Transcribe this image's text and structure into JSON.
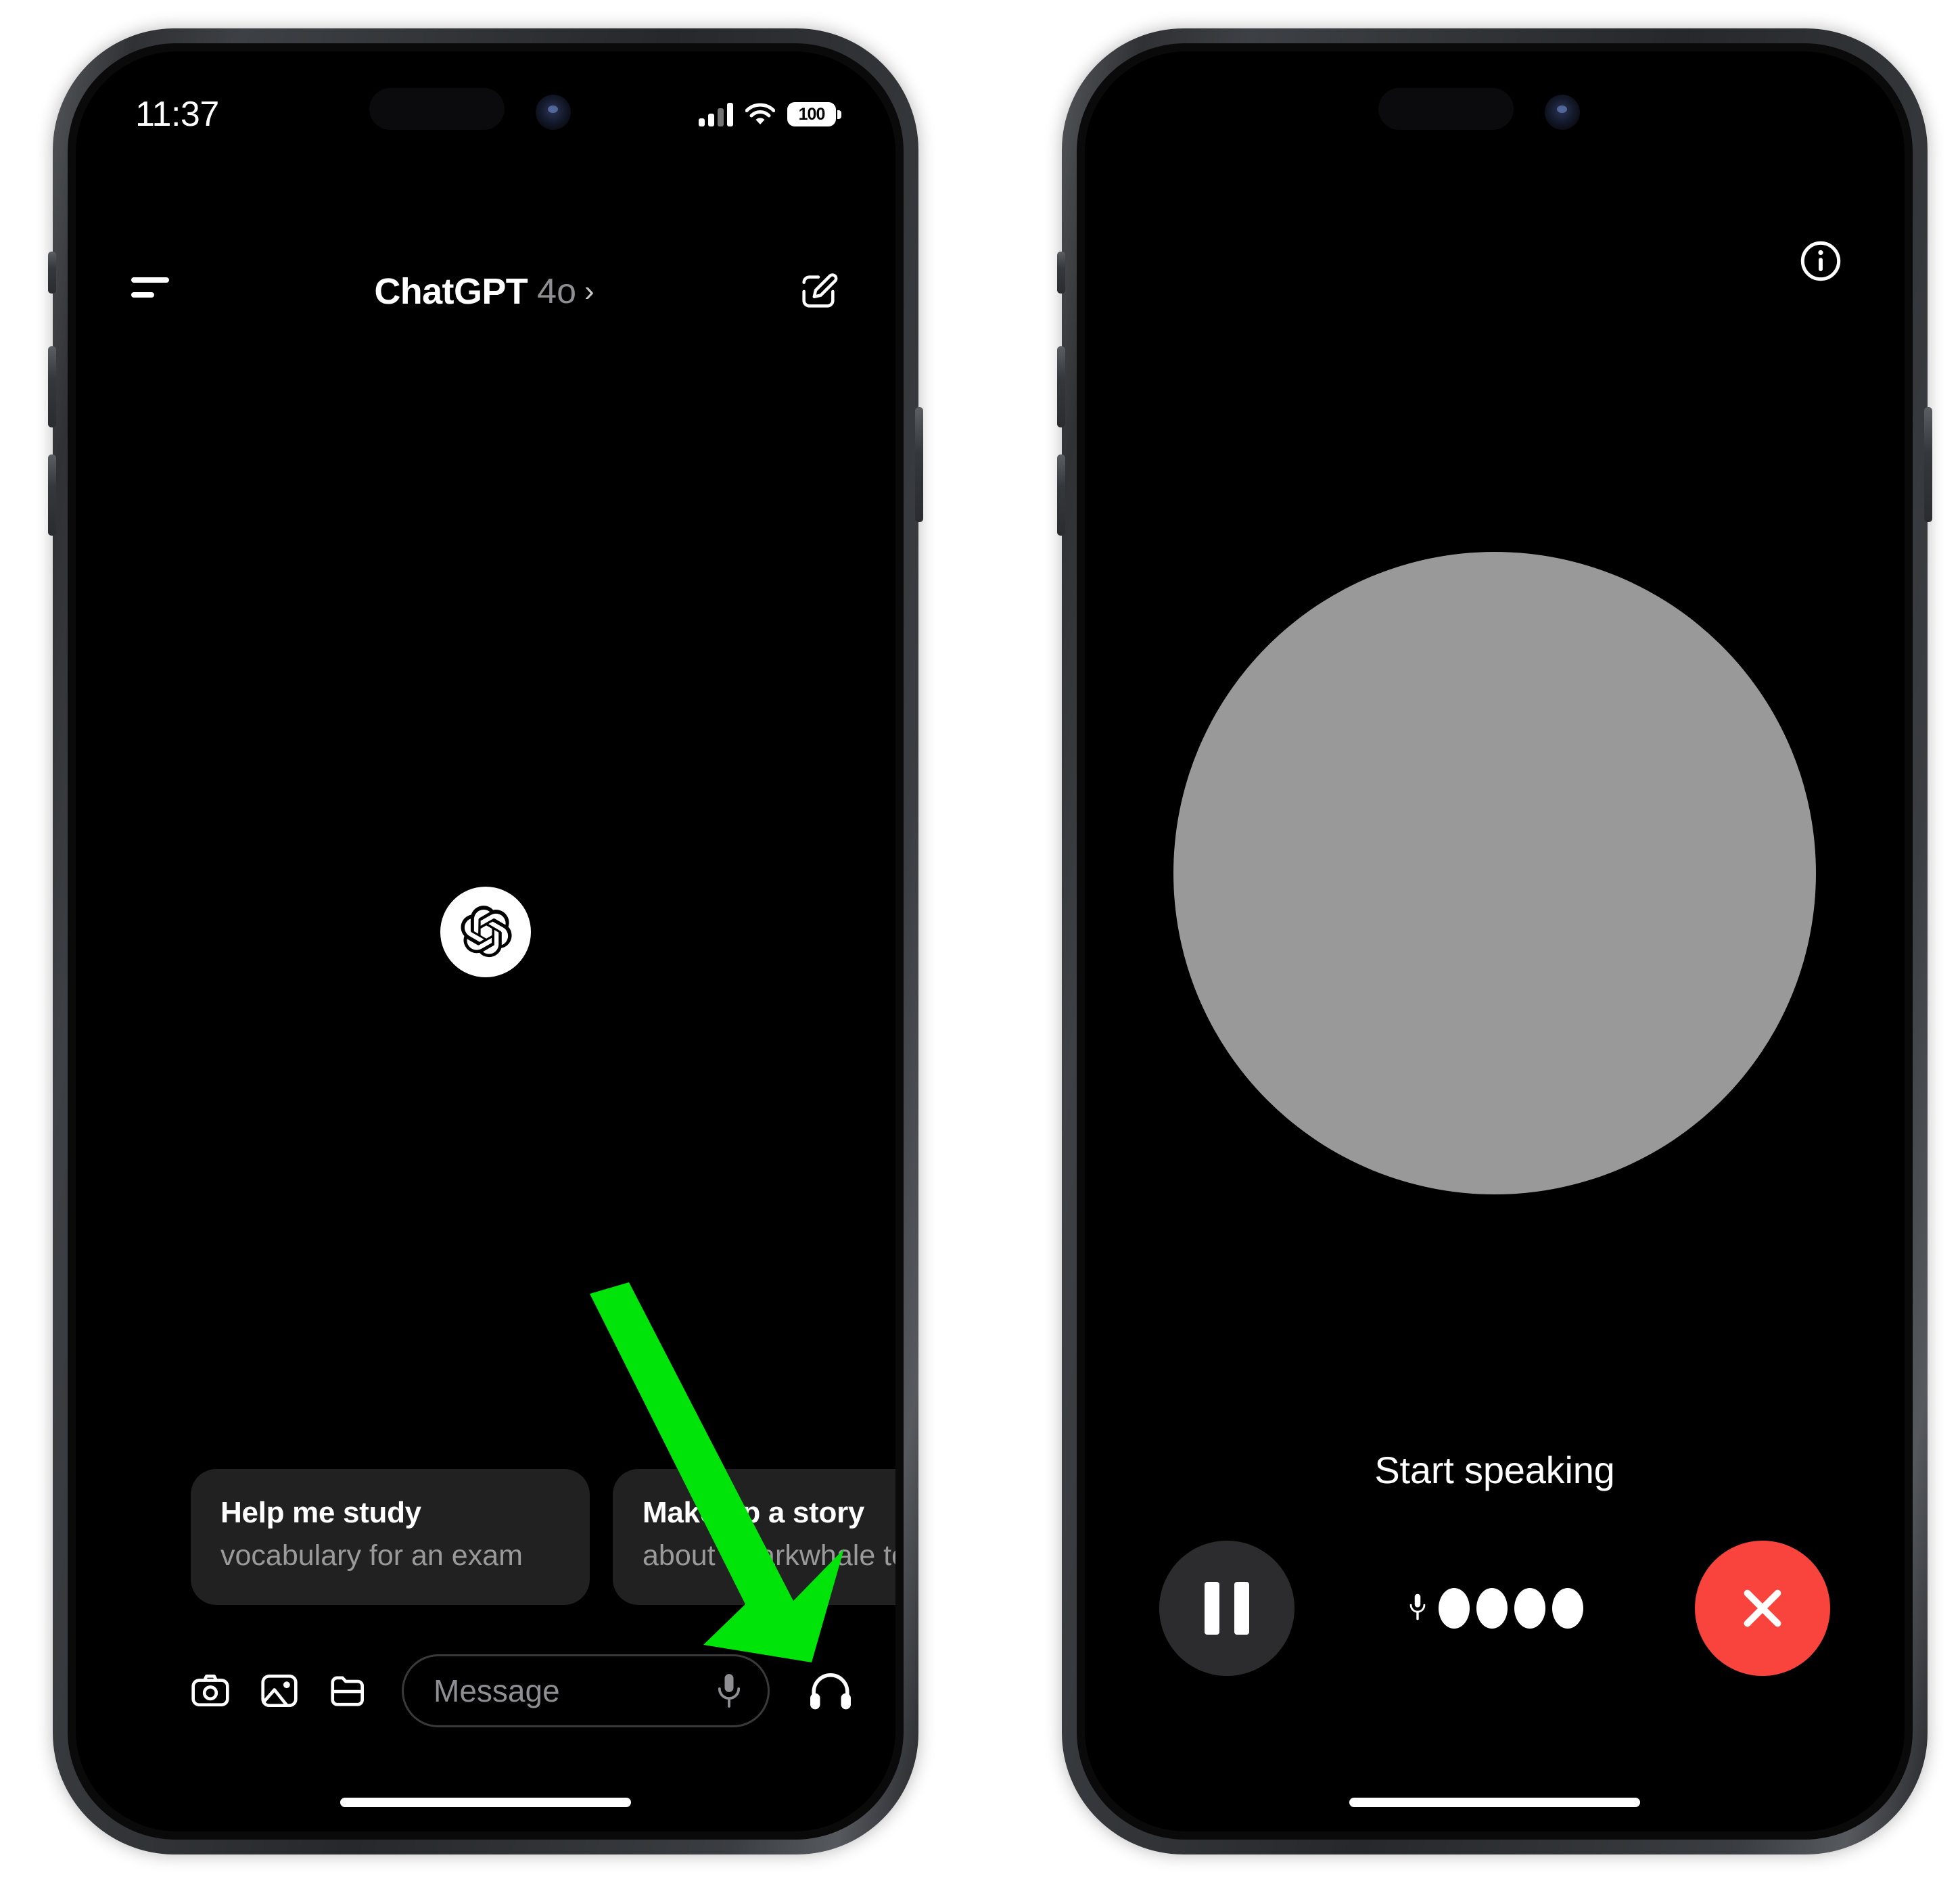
{
  "annotation": {
    "arrow_color": "#00e40a",
    "arrow_label": "points at headphones voice-mode button"
  },
  "phone_left": {
    "status_bar": {
      "time": "11:37",
      "signal_icon": "cellular-bars-icon",
      "wifi_icon": "wifi-icon",
      "battery_level": "100"
    },
    "navbar": {
      "menu_icon": "hamburger-menu-icon",
      "app_name": "ChatGPT",
      "model": "4o",
      "chevron": "›",
      "compose_icon": "compose-new-chat-icon"
    },
    "empty_state": {
      "logo_icon": "openai-logo-icon"
    },
    "suggestions": [
      {
        "title": "Help me study",
        "subtitle": "vocabulary for an exam"
      },
      {
        "title": "Make up a story",
        "subtitle": "about Sharkwhale tooth-b"
      }
    ],
    "composer": {
      "camera_icon": "camera-icon",
      "photos_icon": "photo-library-icon",
      "files_icon": "folder-files-icon",
      "placeholder": "Message",
      "input_value": "",
      "mic_icon": "microphone-icon",
      "voice_mode_icon": "headphones-icon"
    }
  },
  "phone_right": {
    "status_bar": {
      "time": "",
      "battery_level": ""
    },
    "info_icon": "info-circle-icon",
    "orb": {
      "color": "#999999",
      "name": "voice-assistant-orb"
    },
    "status_text": "Start speaking",
    "controls": {
      "pause_icon": "pause-icon",
      "mic_icon": "microphone-icon",
      "level_dots": 4,
      "close_icon": "close-x-icon",
      "close_color": "#f8443c"
    }
  }
}
